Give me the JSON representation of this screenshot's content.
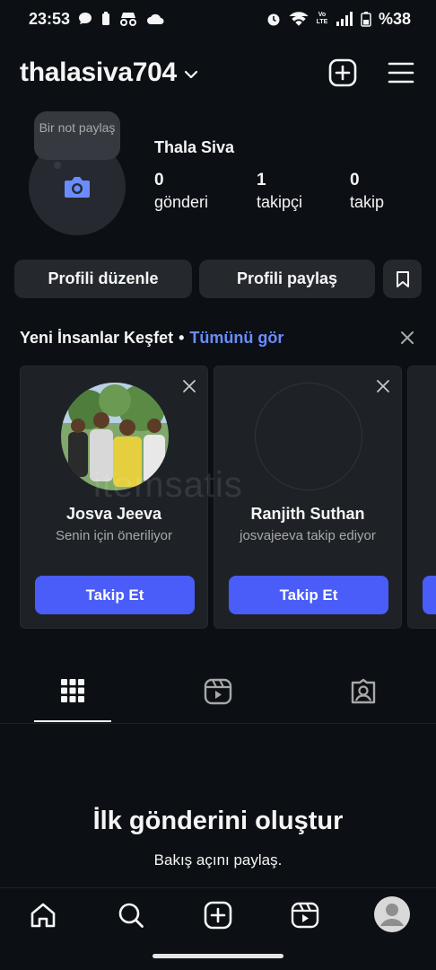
{
  "status_bar": {
    "time": "23:53",
    "battery": "%38",
    "volte": "Vo LTE"
  },
  "header": {
    "username": "thalasiva704"
  },
  "profile": {
    "note_text": "Bir not paylaş",
    "full_name": "Thala Siva",
    "stats": [
      {
        "value": "0",
        "label": "gönderi"
      },
      {
        "value": "1",
        "label": "takipçi"
      },
      {
        "value": "0",
        "label": "takip"
      }
    ]
  },
  "actions": {
    "edit_profile": "Profili düzenle",
    "share_profile": "Profili paylaş"
  },
  "discover": {
    "title": "Yeni İnsanlar Keşfet",
    "bullet": "•",
    "see_all": "Tümünü gör",
    "cards": [
      {
        "name": "Josva Jeeva",
        "subtitle": "Senin için öneriliyor",
        "button": "Takip Et"
      },
      {
        "name": "Ranjith Suthan",
        "subtitle": "josvajeeva takip ediyor",
        "button": "Takip Et"
      }
    ]
  },
  "watermark": "itemsatis",
  "empty_state": {
    "title": "İlk gönderini oluştur",
    "subtitle": "Bakış açını paylaş."
  },
  "colors": {
    "background": "#0c1014",
    "button": "#25292e",
    "accent": "#4a5df9",
    "link": "#6b8cff"
  },
  "icons": {
    "header": [
      "chevron-down-icon",
      "add-icon",
      "menu-icon"
    ],
    "tabs": [
      "grid-icon",
      "reels-icon",
      "tagged-icon"
    ],
    "nav": [
      "home-icon",
      "search-icon",
      "create-icon",
      "reels-icon",
      "profile-avatar"
    ]
  }
}
